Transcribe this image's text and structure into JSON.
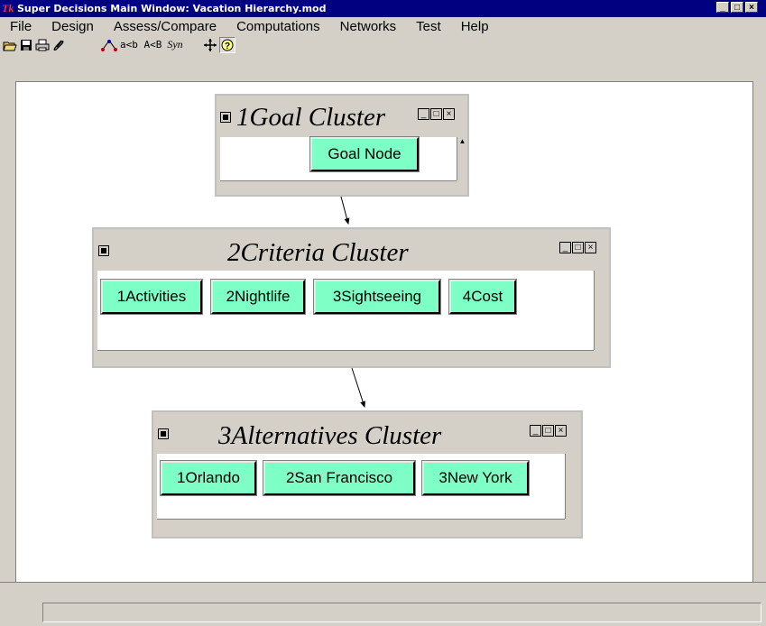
{
  "window": {
    "title": "Super Decisions Main Window: Vacation Hierarchy.mod"
  },
  "menu": [
    "File",
    "Design",
    "Assess/Compare",
    "Computations",
    "Networks",
    "Test",
    "Help"
  ],
  "toolbar": {
    "compare_text": "a<b A<B",
    "syn_text": "Syn"
  },
  "clusters": [
    {
      "title": "1Goal Cluster",
      "nodes": [
        "Goal Node"
      ]
    },
    {
      "title": "2Criteria Cluster",
      "nodes": [
        "1Activities",
        "2Nightlife",
        "3Sightseeing",
        "4Cost"
      ]
    },
    {
      "title": "3Alternatives Cluster",
      "nodes": [
        "1Orlando",
        "2San Francisco",
        "3New York"
      ]
    }
  ],
  "colors": {
    "node_fill": "#7dffc6",
    "titlebar": "#000080",
    "canvas": "#ffffff"
  },
  "icons": [
    "open-icon",
    "save-icon",
    "print-icon",
    "attach-icon",
    "compare-icon",
    "syn-icon",
    "move-icon",
    "help-icon"
  ]
}
